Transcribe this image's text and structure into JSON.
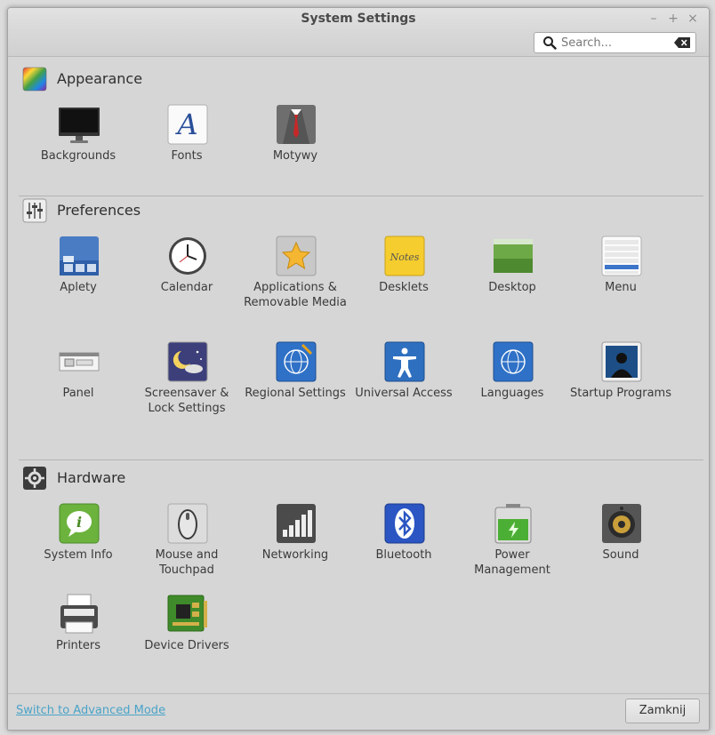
{
  "window": {
    "title": "System Settings",
    "minimize_glyph": "–",
    "maximize_glyph": "+",
    "close_glyph": "×"
  },
  "search": {
    "placeholder": "Search...",
    "value": "",
    "icon": "search-icon",
    "clear_icon": "clear-icon"
  },
  "sections": {
    "appearance": {
      "title": "Appearance",
      "icon": "appearance-icon",
      "items": [
        {
          "label": "Backgrounds",
          "icon": "backgrounds-icon"
        },
        {
          "label": "Fonts",
          "icon": "fonts-icon"
        },
        {
          "label": "Motywy",
          "icon": "themes-icon"
        }
      ]
    },
    "preferences": {
      "title": "Preferences",
      "icon": "preferences-icon",
      "items": [
        {
          "label": "Aplety",
          "icon": "applets-icon"
        },
        {
          "label": "Calendar",
          "icon": "calendar-icon"
        },
        {
          "label": "Applications & Removable Media",
          "icon": "removable-media-icon"
        },
        {
          "label": "Desklets",
          "icon": "desklets-icon"
        },
        {
          "label": "Desktop",
          "icon": "desktop-icon"
        },
        {
          "label": "Menu",
          "icon": "menu-icon"
        },
        {
          "label": "Panel",
          "icon": "panel-icon"
        },
        {
          "label": "Screensaver & Lock Settings",
          "icon": "screensaver-icon"
        },
        {
          "label": "Regional Settings",
          "icon": "regional-settings-icon"
        },
        {
          "label": "Universal Access",
          "icon": "universal-access-icon"
        },
        {
          "label": "Languages",
          "icon": "languages-icon"
        },
        {
          "label": "Startup Programs",
          "icon": "startup-programs-icon"
        }
      ]
    },
    "hardware": {
      "title": "Hardware",
      "icon": "hardware-icon",
      "items": [
        {
          "label": "System Info",
          "icon": "system-info-icon"
        },
        {
          "label": "Mouse and Touchpad",
          "icon": "mouse-icon"
        },
        {
          "label": "Networking",
          "icon": "networking-icon"
        },
        {
          "label": "Bluetooth",
          "icon": "bluetooth-icon"
        },
        {
          "label": "Power Management",
          "icon": "power-icon"
        },
        {
          "label": "Sound",
          "icon": "sound-icon"
        },
        {
          "label": "Printers",
          "icon": "printers-icon"
        },
        {
          "label": "Device Drivers",
          "icon": "device-drivers-icon"
        }
      ]
    }
  },
  "footer": {
    "advanced_link": "Switch to Advanced Mode",
    "close_button": "Zamknij"
  },
  "colors": {
    "link": "#4aa3c8",
    "window_bg": "#d6d6d6"
  }
}
